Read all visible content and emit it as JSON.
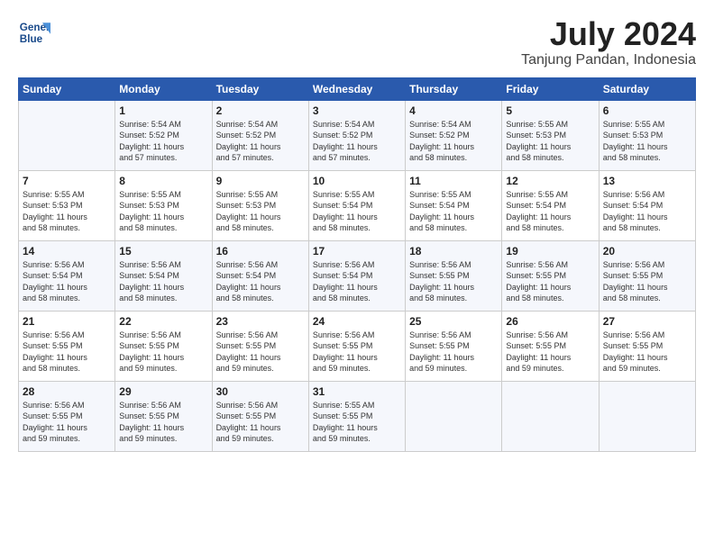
{
  "header": {
    "logo_line1": "General",
    "logo_line2": "Blue",
    "month": "July 2024",
    "location": "Tanjung Pandan, Indonesia"
  },
  "days_of_week": [
    "Sunday",
    "Monday",
    "Tuesday",
    "Wednesday",
    "Thursday",
    "Friday",
    "Saturday"
  ],
  "weeks": [
    [
      {
        "day": "",
        "text": ""
      },
      {
        "day": "1",
        "text": "Sunrise: 5:54 AM\nSunset: 5:52 PM\nDaylight: 11 hours\nand 57 minutes."
      },
      {
        "day": "2",
        "text": "Sunrise: 5:54 AM\nSunset: 5:52 PM\nDaylight: 11 hours\nand 57 minutes."
      },
      {
        "day": "3",
        "text": "Sunrise: 5:54 AM\nSunset: 5:52 PM\nDaylight: 11 hours\nand 57 minutes."
      },
      {
        "day": "4",
        "text": "Sunrise: 5:54 AM\nSunset: 5:52 PM\nDaylight: 11 hours\nand 58 minutes."
      },
      {
        "day": "5",
        "text": "Sunrise: 5:55 AM\nSunset: 5:53 PM\nDaylight: 11 hours\nand 58 minutes."
      },
      {
        "day": "6",
        "text": "Sunrise: 5:55 AM\nSunset: 5:53 PM\nDaylight: 11 hours\nand 58 minutes."
      }
    ],
    [
      {
        "day": "7",
        "text": "Sunrise: 5:55 AM\nSunset: 5:53 PM\nDaylight: 11 hours\nand 58 minutes."
      },
      {
        "day": "8",
        "text": "Sunrise: 5:55 AM\nSunset: 5:53 PM\nDaylight: 11 hours\nand 58 minutes."
      },
      {
        "day": "9",
        "text": "Sunrise: 5:55 AM\nSunset: 5:53 PM\nDaylight: 11 hours\nand 58 minutes."
      },
      {
        "day": "10",
        "text": "Sunrise: 5:55 AM\nSunset: 5:54 PM\nDaylight: 11 hours\nand 58 minutes."
      },
      {
        "day": "11",
        "text": "Sunrise: 5:55 AM\nSunset: 5:54 PM\nDaylight: 11 hours\nand 58 minutes."
      },
      {
        "day": "12",
        "text": "Sunrise: 5:55 AM\nSunset: 5:54 PM\nDaylight: 11 hours\nand 58 minutes."
      },
      {
        "day": "13",
        "text": "Sunrise: 5:56 AM\nSunset: 5:54 PM\nDaylight: 11 hours\nand 58 minutes."
      }
    ],
    [
      {
        "day": "14",
        "text": "Sunrise: 5:56 AM\nSunset: 5:54 PM\nDaylight: 11 hours\nand 58 minutes."
      },
      {
        "day": "15",
        "text": "Sunrise: 5:56 AM\nSunset: 5:54 PM\nDaylight: 11 hours\nand 58 minutes."
      },
      {
        "day": "16",
        "text": "Sunrise: 5:56 AM\nSunset: 5:54 PM\nDaylight: 11 hours\nand 58 minutes."
      },
      {
        "day": "17",
        "text": "Sunrise: 5:56 AM\nSunset: 5:54 PM\nDaylight: 11 hours\nand 58 minutes."
      },
      {
        "day": "18",
        "text": "Sunrise: 5:56 AM\nSunset: 5:55 PM\nDaylight: 11 hours\nand 58 minutes."
      },
      {
        "day": "19",
        "text": "Sunrise: 5:56 AM\nSunset: 5:55 PM\nDaylight: 11 hours\nand 58 minutes."
      },
      {
        "day": "20",
        "text": "Sunrise: 5:56 AM\nSunset: 5:55 PM\nDaylight: 11 hours\nand 58 minutes."
      }
    ],
    [
      {
        "day": "21",
        "text": "Sunrise: 5:56 AM\nSunset: 5:55 PM\nDaylight: 11 hours\nand 58 minutes."
      },
      {
        "day": "22",
        "text": "Sunrise: 5:56 AM\nSunset: 5:55 PM\nDaylight: 11 hours\nand 59 minutes."
      },
      {
        "day": "23",
        "text": "Sunrise: 5:56 AM\nSunset: 5:55 PM\nDaylight: 11 hours\nand 59 minutes."
      },
      {
        "day": "24",
        "text": "Sunrise: 5:56 AM\nSunset: 5:55 PM\nDaylight: 11 hours\nand 59 minutes."
      },
      {
        "day": "25",
        "text": "Sunrise: 5:56 AM\nSunset: 5:55 PM\nDaylight: 11 hours\nand 59 minutes."
      },
      {
        "day": "26",
        "text": "Sunrise: 5:56 AM\nSunset: 5:55 PM\nDaylight: 11 hours\nand 59 minutes."
      },
      {
        "day": "27",
        "text": "Sunrise: 5:56 AM\nSunset: 5:55 PM\nDaylight: 11 hours\nand 59 minutes."
      }
    ],
    [
      {
        "day": "28",
        "text": "Sunrise: 5:56 AM\nSunset: 5:55 PM\nDaylight: 11 hours\nand 59 minutes."
      },
      {
        "day": "29",
        "text": "Sunrise: 5:56 AM\nSunset: 5:55 PM\nDaylight: 11 hours\nand 59 minutes."
      },
      {
        "day": "30",
        "text": "Sunrise: 5:56 AM\nSunset: 5:55 PM\nDaylight: 11 hours\nand 59 minutes."
      },
      {
        "day": "31",
        "text": "Sunrise: 5:55 AM\nSunset: 5:55 PM\nDaylight: 11 hours\nand 59 minutes."
      },
      {
        "day": "",
        "text": ""
      },
      {
        "day": "",
        "text": ""
      },
      {
        "day": "",
        "text": ""
      }
    ]
  ]
}
